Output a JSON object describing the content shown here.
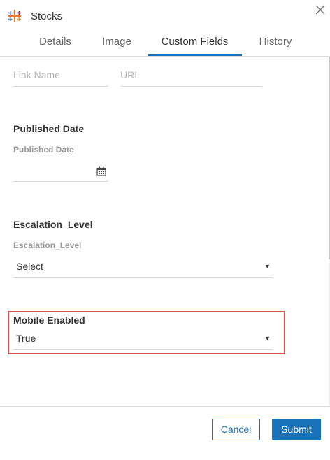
{
  "header": {
    "title": "Stocks",
    "logo_icon": "tableau-logo-icon",
    "close_icon": "close-icon"
  },
  "tabs": [
    {
      "label": "Details"
    },
    {
      "label": "Image"
    },
    {
      "label": "Custom Fields",
      "active": true
    },
    {
      "label": "History"
    }
  ],
  "link": {
    "name_placeholder": "Link Name",
    "url_placeholder": "URL"
  },
  "published_date": {
    "title": "Published Date",
    "sublabel": "Published Date",
    "value": "",
    "icon": "calendar-icon"
  },
  "escalation_level": {
    "title": "Escalation_Level",
    "sublabel": "Escalation_Level",
    "selected": "Select"
  },
  "mobile_enabled": {
    "title": "Mobile Enabled",
    "selected": "True"
  },
  "footer": {
    "cancel_label": "Cancel",
    "submit_label": "Submit"
  },
  "colors": {
    "accent": "#1a73b8",
    "highlight": "#d9534f"
  }
}
